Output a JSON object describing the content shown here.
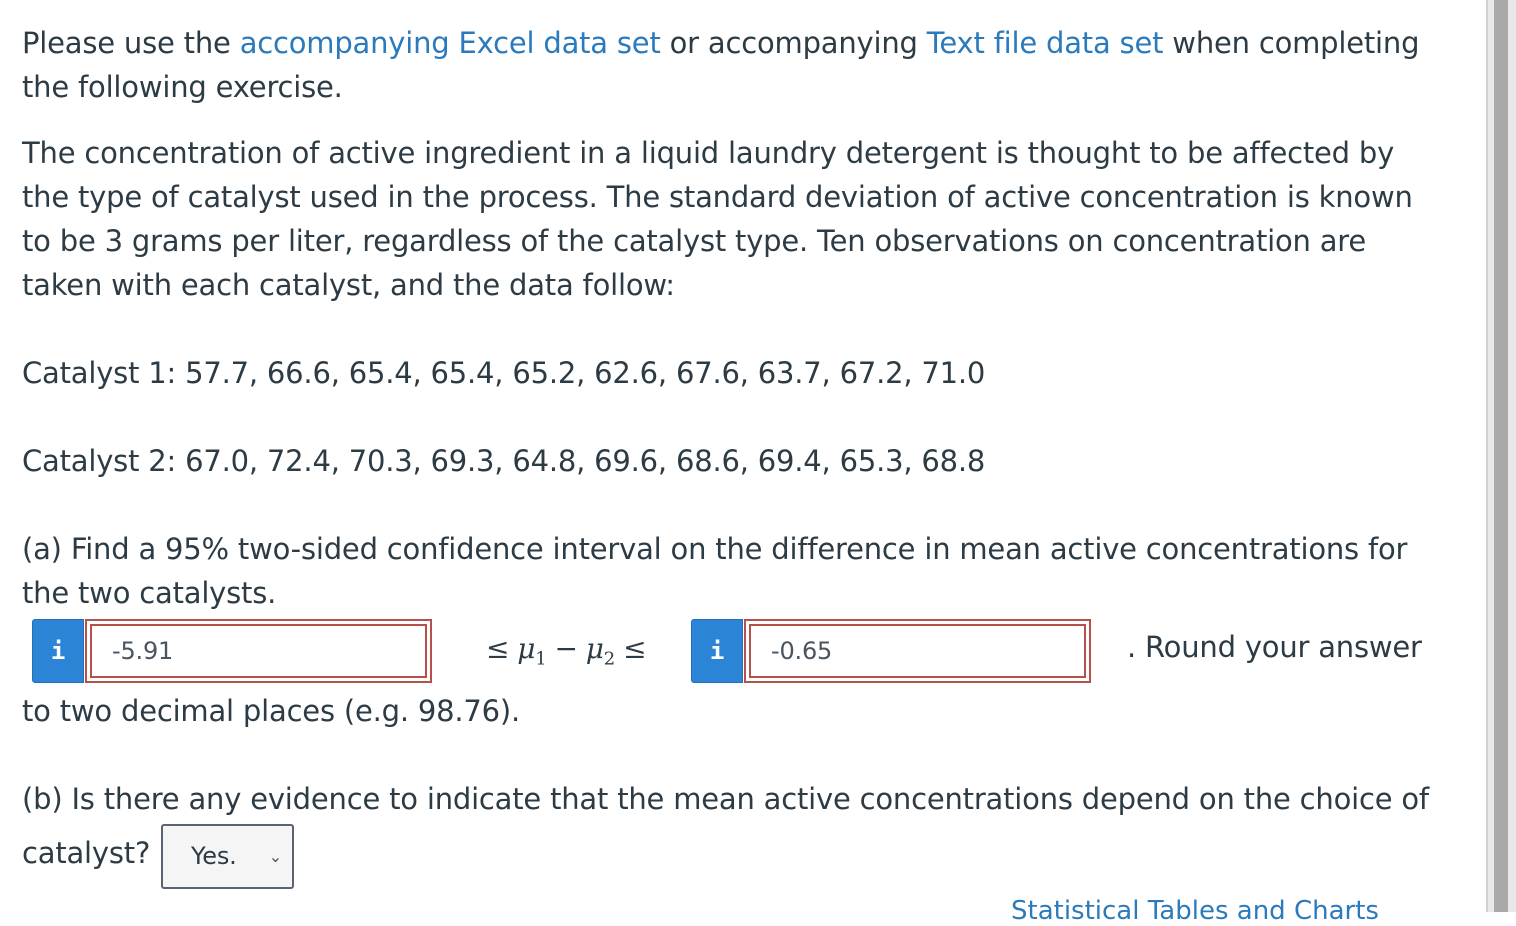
{
  "intro": {
    "before": "Please use the ",
    "excel_link": "accompanying Excel data set",
    "middle": " or accompanying ",
    "text_link": "Text file data set",
    "after": " when completing the following exercise."
  },
  "problem_text": "The concentration of active ingredient in a liquid laundry detergent is thought to be affected by the type of catalyst used in the process. The standard deviation of active concentration is known to be 3 grams per liter, regardless of the catalyst type. Ten observations on concentration are taken with each catalyst, and the data follow:",
  "catalyst1": "Catalyst 1: 57.7, 66.6, 65.4, 65.4, 65.2, 62.6, 67.6, 63.7, 67.2, 71.0",
  "catalyst2": "Catalyst 2: 67.0, 72.4, 70.3, 69.3, 64.8, 69.6, 68.6, 69.4, 65.3, 68.8",
  "part_a": {
    "question": "(a) Find a 95% two-sided confidence interval on the difference in mean active concentrations for the two catalysts.",
    "info_label": "i",
    "lower_value": "-5.91",
    "upper_value": "-0.65",
    "math_le1": "≤",
    "math_mu": "μ",
    "math_sub1": "1",
    "math_minus": "−",
    "math_sub2": "2",
    "math_le2": "≤",
    "round_text_1": ". Round your answer",
    "round_text_2": "to two decimal places (e.g. 98.76)."
  },
  "part_b": {
    "question_line1": "(b) Is there any evidence to indicate that the mean active concentrations depend on the choice of",
    "question_line2": "catalyst?",
    "selected": "Yes."
  },
  "footer_link": "Statistical Tables and Charts"
}
